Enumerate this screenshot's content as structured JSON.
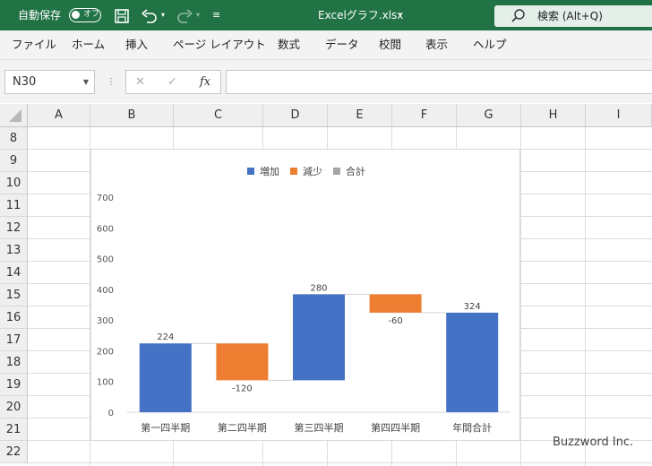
{
  "titlebar": {
    "autosave_label": "自動保存",
    "autosave_toggle": "オフ",
    "filename": "Excelグラフ.xlsx",
    "search_text": "検索 (Alt+Q)"
  },
  "menu": [
    "ファイル",
    "ホーム",
    "挿入",
    "ページ レイアウト",
    "数式",
    "データ",
    "校閲",
    "表示",
    "ヘルプ"
  ],
  "formula_bar": {
    "name_box": "N30",
    "fx_label": "fx",
    "formula": ""
  },
  "columns": [
    "A",
    "B",
    "C",
    "D",
    "E",
    "F",
    "G",
    "H",
    "I"
  ],
  "rows": [
    "8",
    "9",
    "10",
    "11",
    "12",
    "13",
    "14",
    "15",
    "16",
    "17",
    "18",
    "19",
    "20",
    "21",
    "22"
  ],
  "chart_data": {
    "type": "bar",
    "subtype": "waterfall",
    "categories": [
      "第一四半期",
      "第二四半期",
      "第三四半期",
      "第四四半期",
      "年間合計"
    ],
    "values": [
      224,
      -120,
      280,
      -60,
      324
    ],
    "data_labels": [
      "224",
      "-120",
      "280",
      "-60",
      "324"
    ],
    "kinds": [
      "increase",
      "decrease",
      "increase",
      "decrease",
      "total"
    ],
    "legend": [
      {
        "name": "増加",
        "color": "#4472c4"
      },
      {
        "name": "減少",
        "color": "#ed7d31"
      },
      {
        "name": "合計",
        "color": "#a5a5a5"
      }
    ],
    "legend_position": "top",
    "bar_colors": [
      "#4472c4",
      "#ed7d31",
      "#4472c4",
      "#ed7d31",
      "#4472c4"
    ],
    "ylim": [
      0,
      700
    ],
    "yticks": [
      0,
      100,
      200,
      300,
      400,
      500,
      600,
      700
    ],
    "grid": false
  },
  "watermark": "Buzzword Inc."
}
